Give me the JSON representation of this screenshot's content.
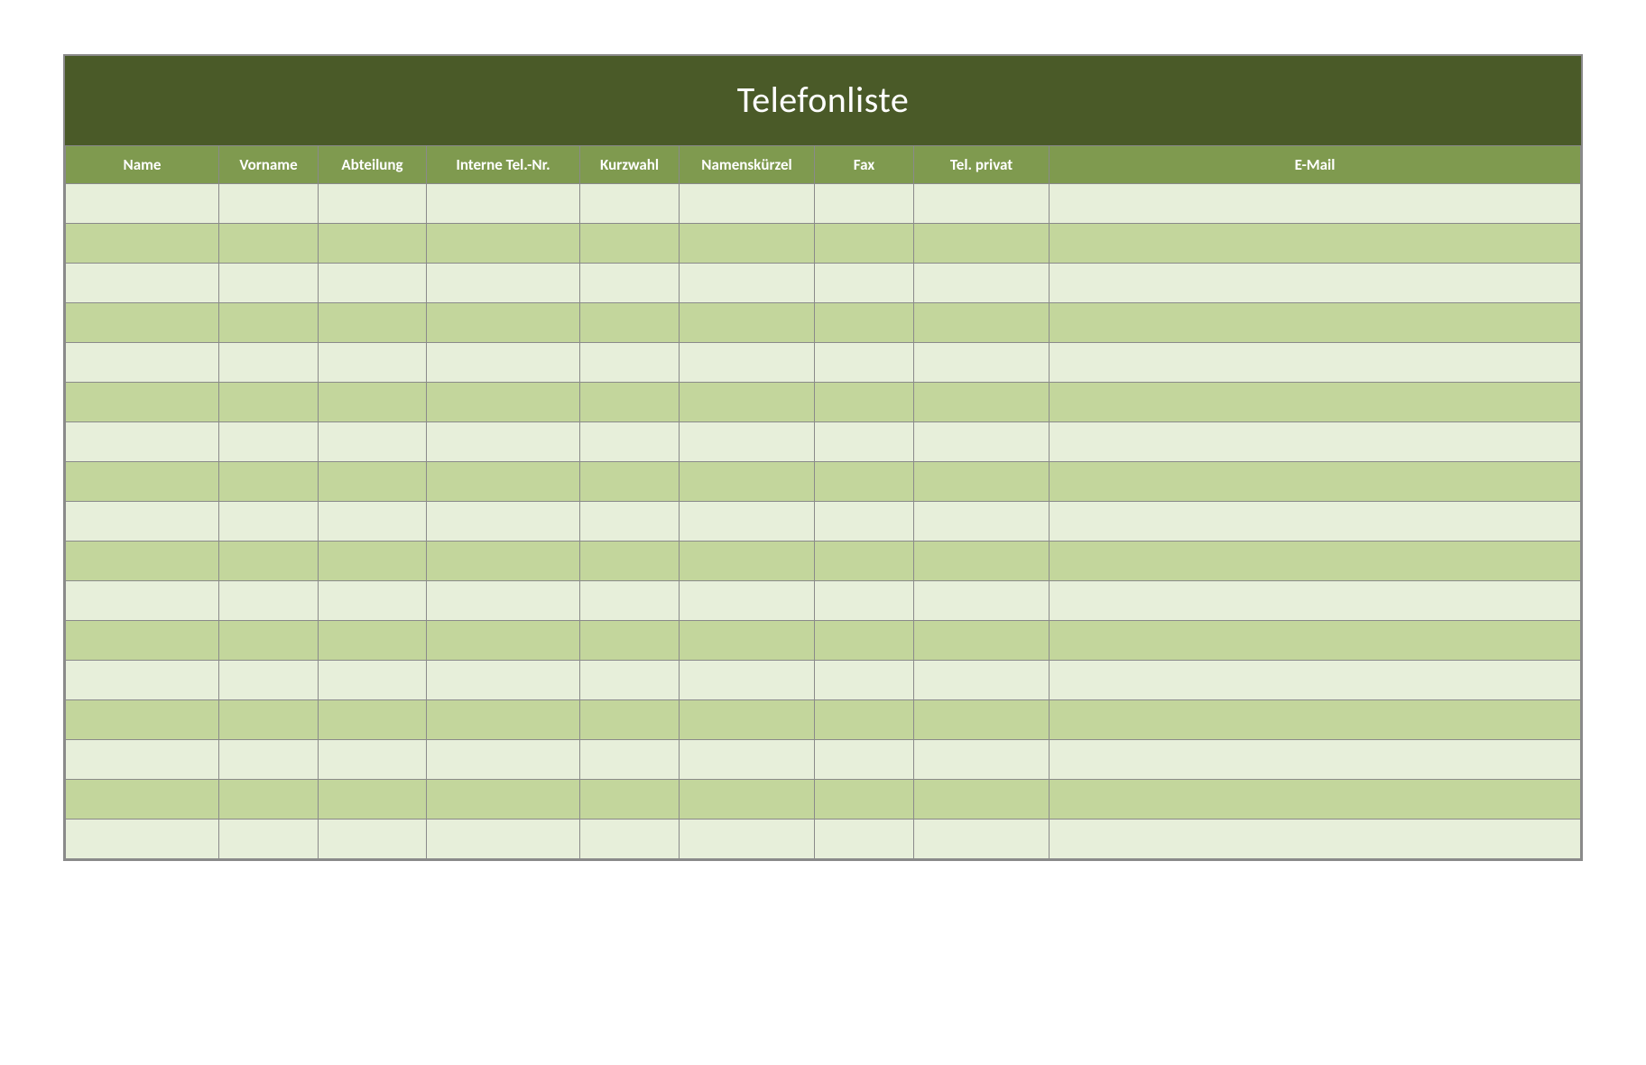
{
  "title": "Telefonliste",
  "columns": [
    "Name",
    "Vorname",
    "Abteilung",
    "Interne Tel.-Nr.",
    "Kurzwahl",
    "Namenskürzel",
    "Fax",
    "Tel. privat",
    "E-Mail"
  ],
  "rows": [
    [
      "",
      "",
      "",
      "",
      "",
      "",
      "",
      "",
      ""
    ],
    [
      "",
      "",
      "",
      "",
      "",
      "",
      "",
      "",
      ""
    ],
    [
      "",
      "",
      "",
      "",
      "",
      "",
      "",
      "",
      ""
    ],
    [
      "",
      "",
      "",
      "",
      "",
      "",
      "",
      "",
      ""
    ],
    [
      "",
      "",
      "",
      "",
      "",
      "",
      "",
      "",
      ""
    ],
    [
      "",
      "",
      "",
      "",
      "",
      "",
      "",
      "",
      ""
    ],
    [
      "",
      "",
      "",
      "",
      "",
      "",
      "",
      "",
      ""
    ],
    [
      "",
      "",
      "",
      "",
      "",
      "",
      "",
      "",
      ""
    ],
    [
      "",
      "",
      "",
      "",
      "",
      "",
      "",
      "",
      ""
    ],
    [
      "",
      "",
      "",
      "",
      "",
      "",
      "",
      "",
      ""
    ],
    [
      "",
      "",
      "",
      "",
      "",
      "",
      "",
      "",
      ""
    ],
    [
      "",
      "",
      "",
      "",
      "",
      "",
      "",
      "",
      ""
    ],
    [
      "",
      "",
      "",
      "",
      "",
      "",
      "",
      "",
      ""
    ],
    [
      "",
      "",
      "",
      "",
      "",
      "",
      "",
      "",
      ""
    ],
    [
      "",
      "",
      "",
      "",
      "",
      "",
      "",
      "",
      ""
    ],
    [
      "",
      "",
      "",
      "",
      "",
      "",
      "",
      "",
      ""
    ],
    [
      "",
      "",
      "",
      "",
      "",
      "",
      "",
      "",
      ""
    ]
  ],
  "colors": {
    "title_bg": "#4a5a28",
    "header_bg": "#7f9a4f",
    "row_light": "#e7efda",
    "row_dark": "#c3d69c",
    "border": "#8a8a8a"
  }
}
